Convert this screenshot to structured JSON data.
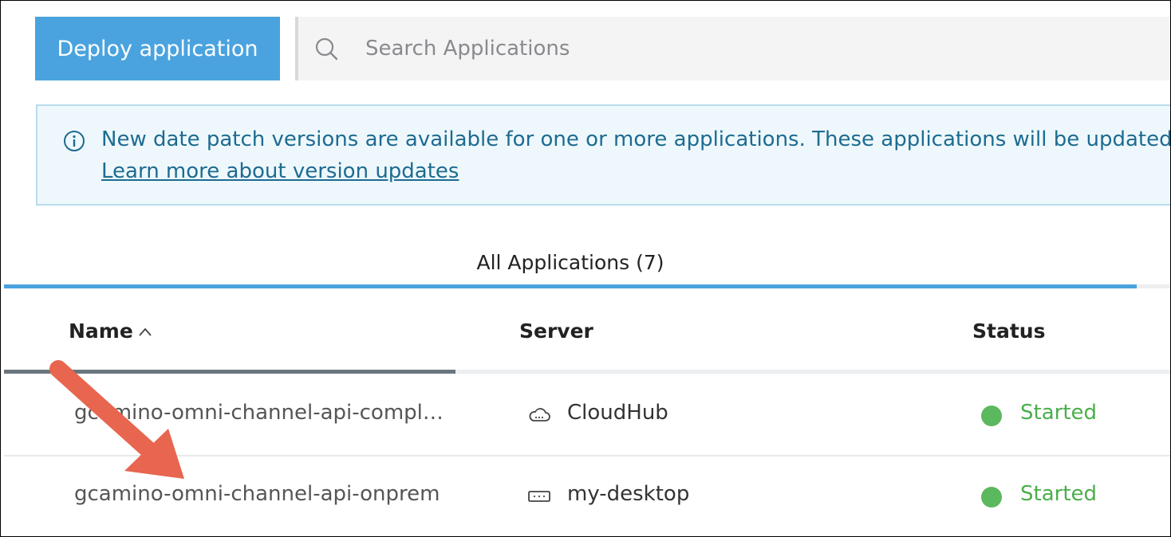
{
  "toolbar": {
    "deploy_label": "Deploy application",
    "search_placeholder": "Search Applications"
  },
  "banner": {
    "icon": "info-icon",
    "message": "New date patch versions are available for one or more applications. These applications will be updated",
    "link_label": "Learn more about version updates"
  },
  "tabs": [
    {
      "label": "All Applications (7)",
      "active": true
    }
  ],
  "table": {
    "columns": [
      {
        "label": "Name",
        "sort": "ascending",
        "sort_icon": "chevron-up-icon"
      },
      {
        "label": "Server"
      },
      {
        "label": "Status"
      }
    ],
    "rows": [
      {
        "name": "gcamino-omni-channel-api-compl…",
        "server_icon": "cloud-icon",
        "server": "CloudHub",
        "status": "Started"
      },
      {
        "name": "gcamino-omni-channel-api-onprem",
        "server_icon": "server-icon",
        "server": "my-desktop",
        "status": "Started"
      }
    ]
  },
  "colors": {
    "accent": "#4aa3df",
    "banner_text": "#1d6b91",
    "status_started": "#5cb85c",
    "annotation_arrow": "#e8654f"
  },
  "annotation": {
    "icon": "arrow-annotation"
  }
}
